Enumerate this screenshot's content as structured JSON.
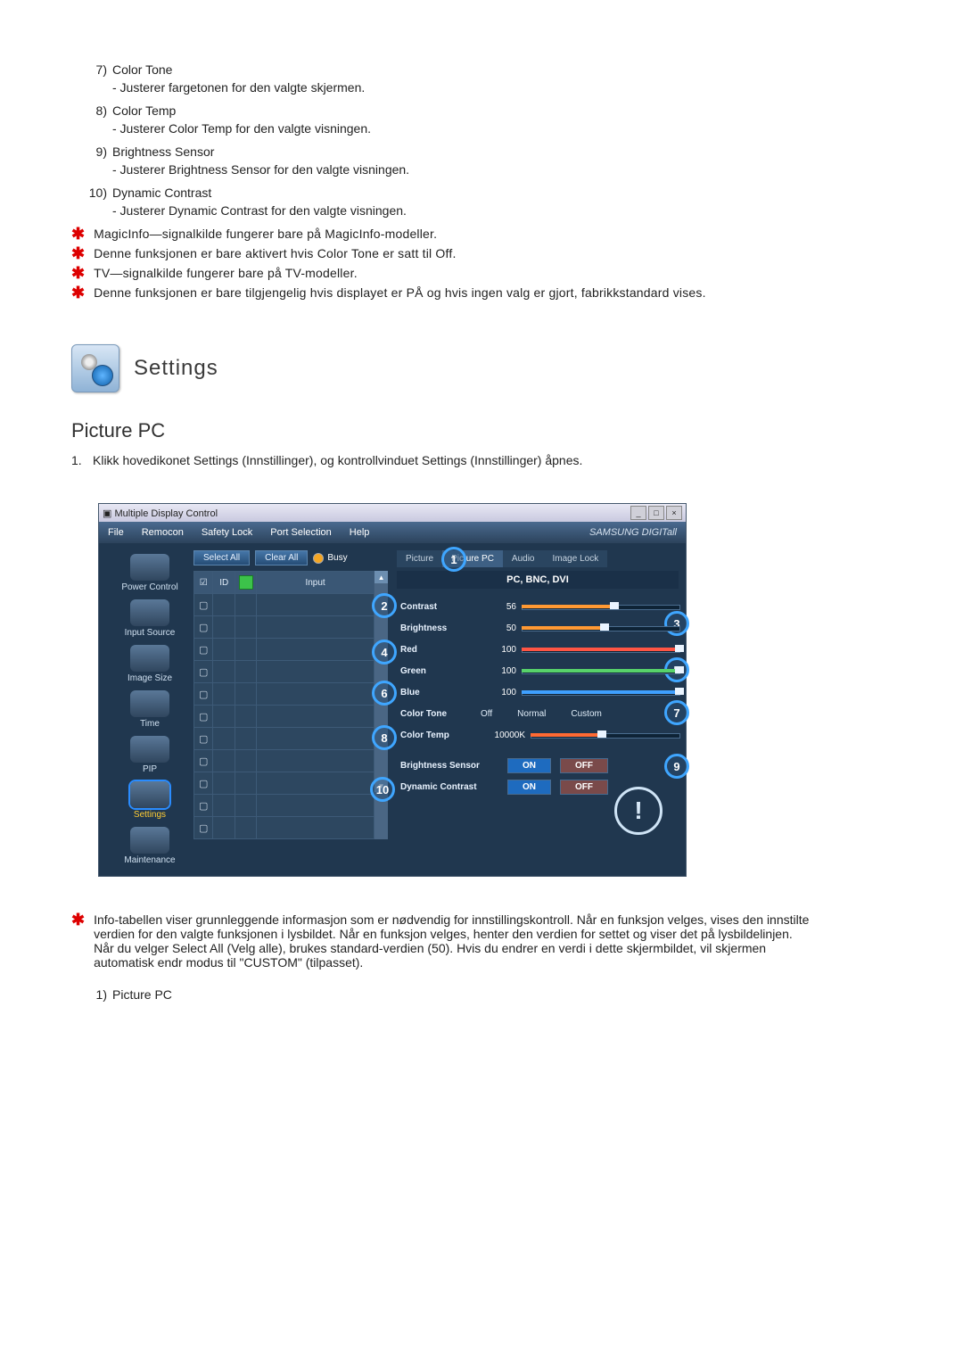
{
  "list_top": [
    {
      "n": "7)",
      "title": "Color Tone",
      "sub": "- Justerer fargetonen for den valgte skjermen."
    },
    {
      "n": "8)",
      "title": "Color Temp",
      "sub": "- Justerer Color Temp for den valgte visningen."
    },
    {
      "n": "9)",
      "title": "Brightness Sensor",
      "sub": "- Justerer Brightness Sensor for den valgte visningen."
    },
    {
      "n": "10)",
      "title": "Dynamic Contrast",
      "sub": "- Justerer Dynamic Contrast for den valgte visningen."
    }
  ],
  "starnotes": [
    "MagicInfo—signalkilde fungerer bare på MagicInfo-modeller.",
    "Denne funksjonen er bare aktivert hvis Color Tone er satt til Off.",
    "TV—signalkilde fungerer bare på TV-modeller.",
    "Denne funksjonen er bare tilgjengelig hvis displayet er PÅ og hvis ingen valg er gjort, fabrikkstandard vises."
  ],
  "section_title": "Settings",
  "subsection": "Picture PC",
  "step1_num": "1.",
  "step1_text": "Klikk hovedikonet Settings (Innstillinger), og kontrollvinduet Settings (Innstillinger) åpnes.",
  "footnote": "Info-tabellen viser grunnleggende informasjon som er nødvendig for innstillingskontroll. Når en funksjon velges, vises den innstilte verdien for den valgte funksjonen i lysbildet. Når en funksjon velges, henter den verdien for settet og viser det på lysbildelinjen. Når du velger Select All (Velg alle), brukes standard-verdien (50). Hvis du endrer en verdi i dette skjermbildet, vil skjermen automatisk endr modus til \"CUSTOM\" (tilpasset).",
  "list_bottom": {
    "n": "1)",
    "title": "Picture PC"
  },
  "app": {
    "title": "Multiple Display Control",
    "menus": [
      "File",
      "Remocon",
      "Safety Lock",
      "Port Selection",
      "Help"
    ],
    "brand": "SAMSUNG DIGITall",
    "nav": [
      "Power Control",
      "Input Source",
      "Image Size",
      "Time",
      "PIP",
      "Settings",
      "Maintenance"
    ],
    "select_all": "Select All",
    "clear_all": "Clear All",
    "busy": "Busy",
    "cols": {
      "chk": "☑",
      "id": "ID",
      "green": "",
      "input": "Input"
    },
    "tabs": [
      "Picture",
      "Picture PC",
      "Audio",
      "Image Lock"
    ],
    "panel_title": "PC, BNC, DVI",
    "sliders": [
      {
        "label": "Contrast",
        "value": "56",
        "pct": 56,
        "color": "#ff9933"
      },
      {
        "label": "Brightness",
        "value": "50",
        "pct": 50,
        "color": "#ff9933"
      },
      {
        "label": "Red",
        "value": "100",
        "pct": 100,
        "color": "#ff5544"
      },
      {
        "label": "Green",
        "value": "100",
        "pct": 100,
        "color": "#57d26a"
      },
      {
        "label": "Blue",
        "value": "100",
        "pct": 100,
        "color": "#3fa0ff"
      }
    ],
    "color_tone": {
      "label": "Color Tone",
      "options": [
        "Off",
        "Normal",
        "Custom"
      ]
    },
    "color_temp": {
      "label": "Color Temp",
      "value": "10000K"
    },
    "bsensor": {
      "label": "Brightness Sensor",
      "on": "ON",
      "off": "OFF"
    },
    "dcontrast": {
      "label": "Dynamic Contrast",
      "on": "ON",
      "off": "OFF"
    }
  }
}
